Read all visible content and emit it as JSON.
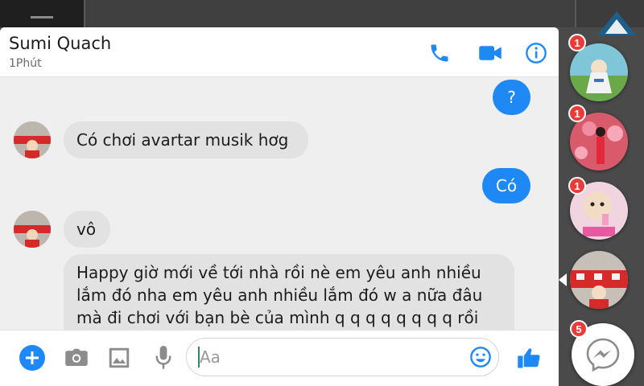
{
  "header": {
    "contact_name": "Sumi Quach",
    "status": "1Phút",
    "icons": [
      "phone-icon",
      "video-camera-icon",
      "info-icon"
    ]
  },
  "messages": [
    {
      "direction": "out",
      "text": "?"
    },
    {
      "direction": "in",
      "text": "Có chơi avartar musik hơg"
    },
    {
      "direction": "out",
      "text": "Có"
    },
    {
      "direction": "in",
      "text": "vô"
    },
    {
      "direction": "in",
      "text": "Happy giờ mới về tới nhà rồi nè em yêu anh nhiều lắm đó nha em yêu anh nhiều lắm đó w a nữa đâu mà đi chơi với bạn bè của mình q q q q q q q q rồi"
    }
  ],
  "composer": {
    "placeholder": "Aa",
    "icons": [
      "add-icon",
      "camera-icon",
      "image-icon",
      "microphone-icon",
      "emoji-icon",
      "thumbs-up-icon"
    ]
  },
  "chat_heads": [
    {
      "badge": "1"
    },
    {
      "badge": "1"
    },
    {
      "badge": "1"
    },
    {
      "badge": ""
    }
  ],
  "messenger_button": {
    "badge": "5"
  },
  "colors": {
    "accent": "#1e88f5",
    "incoming_bubble": "#e2e2e2",
    "badge": "#ea3b3b"
  }
}
